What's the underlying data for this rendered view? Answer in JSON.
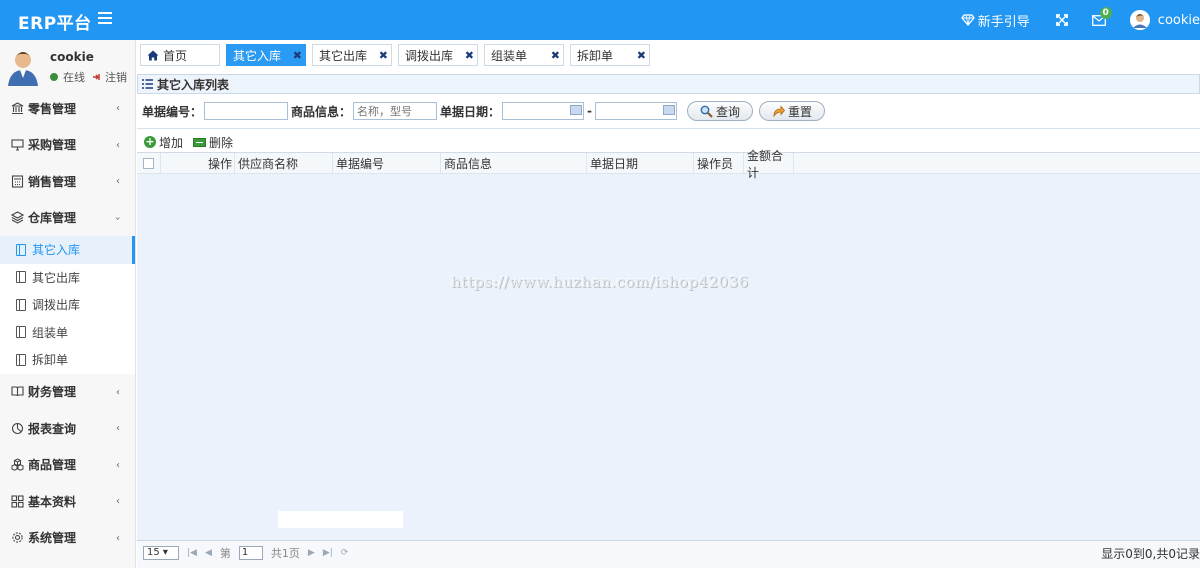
{
  "app": {
    "brand": "ERP平台"
  },
  "header": {
    "guide_label": "新手引导",
    "mail_badge": "0",
    "username": "cookie"
  },
  "user_panel": {
    "name": "cookie",
    "status": "在线",
    "logout": "注销"
  },
  "sidebar": {
    "menu_top": [
      {
        "label": "零售管理",
        "icon": "bank-icon"
      },
      {
        "label": "采购管理",
        "icon": "monitor-icon"
      },
      {
        "label": "销售管理",
        "icon": "calculator-icon"
      },
      {
        "label": "仓库管理",
        "icon": "layers-icon",
        "expanded": true
      }
    ],
    "submenu": [
      {
        "label": "其它入库",
        "active": true
      },
      {
        "label": "其它出库"
      },
      {
        "label": "调拨出库"
      },
      {
        "label": "组装单"
      },
      {
        "label": "拆卸单"
      }
    ],
    "menu_bottom": [
      {
        "label": "财务管理",
        "icon": "book-icon"
      },
      {
        "label": "报表查询",
        "icon": "pie-chart-icon"
      },
      {
        "label": "商品管理",
        "icon": "cubes-icon"
      },
      {
        "label": "基本资料",
        "icon": "grid-icon"
      },
      {
        "label": "系统管理",
        "icon": "gear-icon"
      }
    ]
  },
  "tabs": [
    {
      "label": "首页",
      "closable": false,
      "active": false
    },
    {
      "label": "其它入库",
      "closable": true,
      "active": true
    },
    {
      "label": "其它出库",
      "closable": true,
      "active": false
    },
    {
      "label": "调拨出库",
      "closable": true,
      "active": false
    },
    {
      "label": "组装单",
      "closable": true,
      "active": false
    },
    {
      "label": "拆卸单",
      "closable": true,
      "active": false
    }
  ],
  "panel": {
    "title": "其它入库列表"
  },
  "search": {
    "bill_no_label": "单据编号：",
    "bill_no_value": "",
    "product_label": "商品信息：",
    "product_placeholder": "名称，型号",
    "date_label": "单据日期：",
    "date_sep": "-",
    "query_button": "查询",
    "reset_button": "重置"
  },
  "toolbar": {
    "add_label": "增加",
    "delete_label": "删除"
  },
  "table": {
    "columns": [
      "操作",
      "供应商名称",
      "单据编号",
      "商品信息",
      "单据日期",
      "操作员",
      "金额合计"
    ],
    "rows": []
  },
  "watermark": "https://www.huzhan.com/ishop42036",
  "pager": {
    "page_size": "15",
    "page_prefix": "第",
    "page_value": "1",
    "page_total": "共1页",
    "info": "显示0到0,共0记录"
  },
  "colors": {
    "primary": "#2196f3",
    "grid_bg": "#ebf2fb",
    "active_tab": "#2b9af3"
  }
}
